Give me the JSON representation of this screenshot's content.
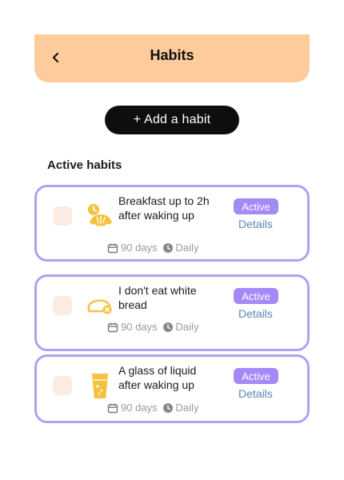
{
  "header": {
    "title": "Habits",
    "back_icon": "chevron-left-icon",
    "background": "#fdcb9c"
  },
  "actions": {
    "add_habit_label": "+ Add a habit"
  },
  "section": {
    "title": "Active habits"
  },
  "habits": [
    {
      "title": "Breakfast up to 2h after waking up",
      "icon": "croissant-clock-icon",
      "status": "Active",
      "details_label": "Details",
      "duration": "90 days",
      "frequency": "Daily"
    },
    {
      "title": "I don't eat white bread",
      "icon": "no-bread-icon",
      "status": "Active",
      "details_label": "Details",
      "duration": "90 days",
      "frequency": "Daily"
    },
    {
      "title": "A glass of liquid after waking up",
      "icon": "glass-icon",
      "status": "Active",
      "details_label": "Details",
      "duration": "90 days",
      "frequency": "Daily"
    }
  ],
  "colors": {
    "accent": "#a48af5",
    "card_border": "#b39ef3",
    "link": "#5b86b8",
    "icon_yellow": "#f5c33b",
    "checkbox_bg": "#fcece3"
  }
}
